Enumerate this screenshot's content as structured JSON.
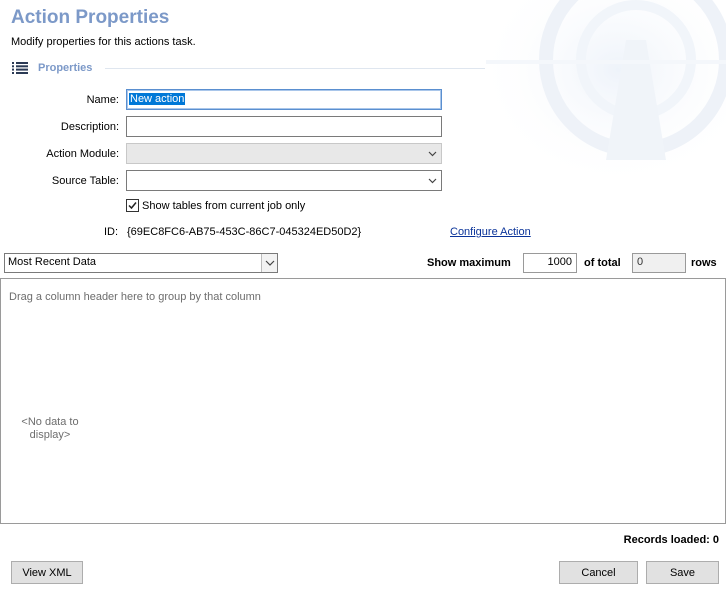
{
  "header": {
    "title": "Action Properties",
    "subtitle": "Modify properties for this actions task."
  },
  "section": {
    "title": "Properties"
  },
  "form": {
    "name_label": "Name:",
    "name_value": "New action",
    "description_label": "Description:",
    "description_value": "",
    "module_label": "Action Module:",
    "module_value": "",
    "source_label": "Source Table:",
    "source_value": "",
    "show_tables_label": "Show tables from current job only",
    "show_tables_checked": true,
    "id_label": "ID:",
    "id_value": "{69EC8FC6-AB75-453C-86C7-045324ED50D2}",
    "configure_link": "Configure Action"
  },
  "data_toolbar": {
    "view_selected": "Most Recent Data",
    "show_max_label": "Show maximum",
    "max_value": "1000",
    "of_total_label": "of total",
    "total_value": "0",
    "rows_label": "rows"
  },
  "grid": {
    "group_hint": "Drag a column header here to group by that column",
    "empty_text": "<No data to display>"
  },
  "footer": {
    "records_loaded": "Records loaded: 0",
    "view_xml": "View XML",
    "cancel": "Cancel",
    "save": "Save"
  },
  "colors": {
    "accent": "#7c99c8",
    "link": "#0a3399",
    "selection": "#0078d7"
  }
}
